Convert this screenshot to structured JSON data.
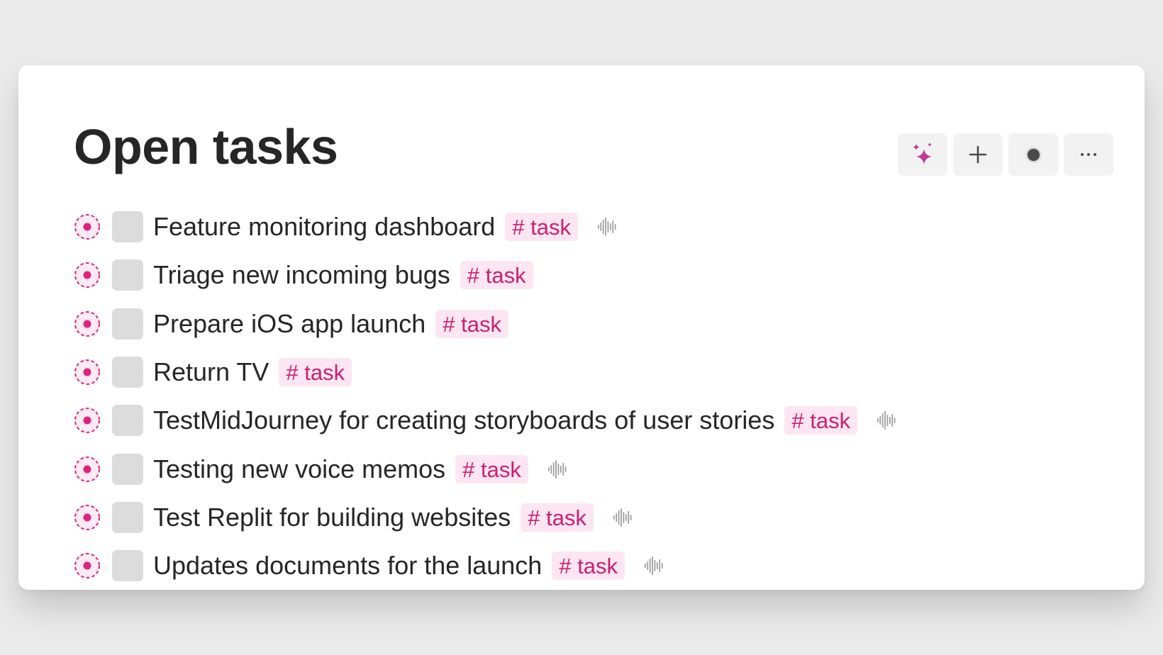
{
  "page": {
    "title": "Open tasks"
  },
  "toolbar": {
    "ai_icon": "sparkles-icon",
    "add_icon": "plus-icon",
    "record_icon": "record-icon",
    "more_icon": "ellipsis-icon"
  },
  "colors": {
    "background": "#ebebeb",
    "card": "#ffffff",
    "accent_pink": "#e0237a",
    "tag_background": "#fde6f1",
    "tag_text": "#cc1f70",
    "checkbox": "#dcdcdc",
    "toolbar_button": "#f2f2f2"
  },
  "tasks": [
    {
      "text": "Feature monitoring dashboard",
      "tag": "# task",
      "has_voice": true
    },
    {
      "text": "Triage new incoming bugs",
      "tag": "# task",
      "has_voice": false
    },
    {
      "text": "Prepare iOS app launch",
      "tag": "# task",
      "has_voice": false
    },
    {
      "text": "Return TV",
      "tag": "# task",
      "has_voice": false
    },
    {
      "text": "TestMidJourney for creating storyboards of user stories",
      "tag": "# task",
      "has_voice": true
    },
    {
      "text": "Testing new voice memos",
      "tag": "# task",
      "has_voice": true
    },
    {
      "text": "Test Replit for building websites",
      "tag": "# task",
      "has_voice": true
    },
    {
      "text": "Updates documents for the launch",
      "tag": "# task",
      "has_voice": true
    }
  ]
}
